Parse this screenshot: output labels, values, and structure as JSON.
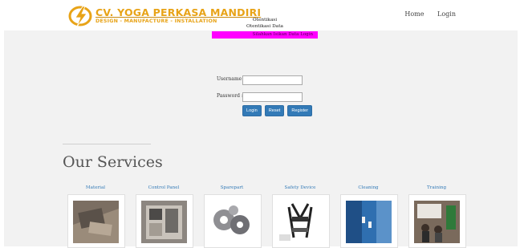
{
  "brand": {
    "name": "CV. YOGA PERKASA MANDIRI",
    "tagline": "DESIGN - MANUFACTURE - INSTALLATION",
    "colors": {
      "primary": "#e8a317",
      "accent": "#c8890e"
    }
  },
  "nav": {
    "items": [
      {
        "label": "Home"
      },
      {
        "label": "Login"
      }
    ]
  },
  "auth": {
    "title": "Otentikasi",
    "subtitle": "Otentikasi Data",
    "alert": "Silahkan Isikan Data Login",
    "username_label": "Username :",
    "password_label": "Password :",
    "buttons": {
      "login": "Login",
      "reset": "Reset",
      "register": "Register"
    }
  },
  "services": {
    "title": "Our Services",
    "items": [
      {
        "label": "Material",
        "icon": "material-photo"
      },
      {
        "label": "Control Panel",
        "icon": "control-panel-photo"
      },
      {
        "label": "Sparepart",
        "icon": "sparepart-photo"
      },
      {
        "label": "Safety Device",
        "icon": "safety-device-photo"
      },
      {
        "label": "Cleaning",
        "icon": "cleaning-photo"
      },
      {
        "label": "Training",
        "icon": "training-photo"
      }
    ]
  },
  "colors": {
    "button": "#337ab7",
    "alert_bg": "#ff00ff",
    "link": "#337ab7"
  }
}
